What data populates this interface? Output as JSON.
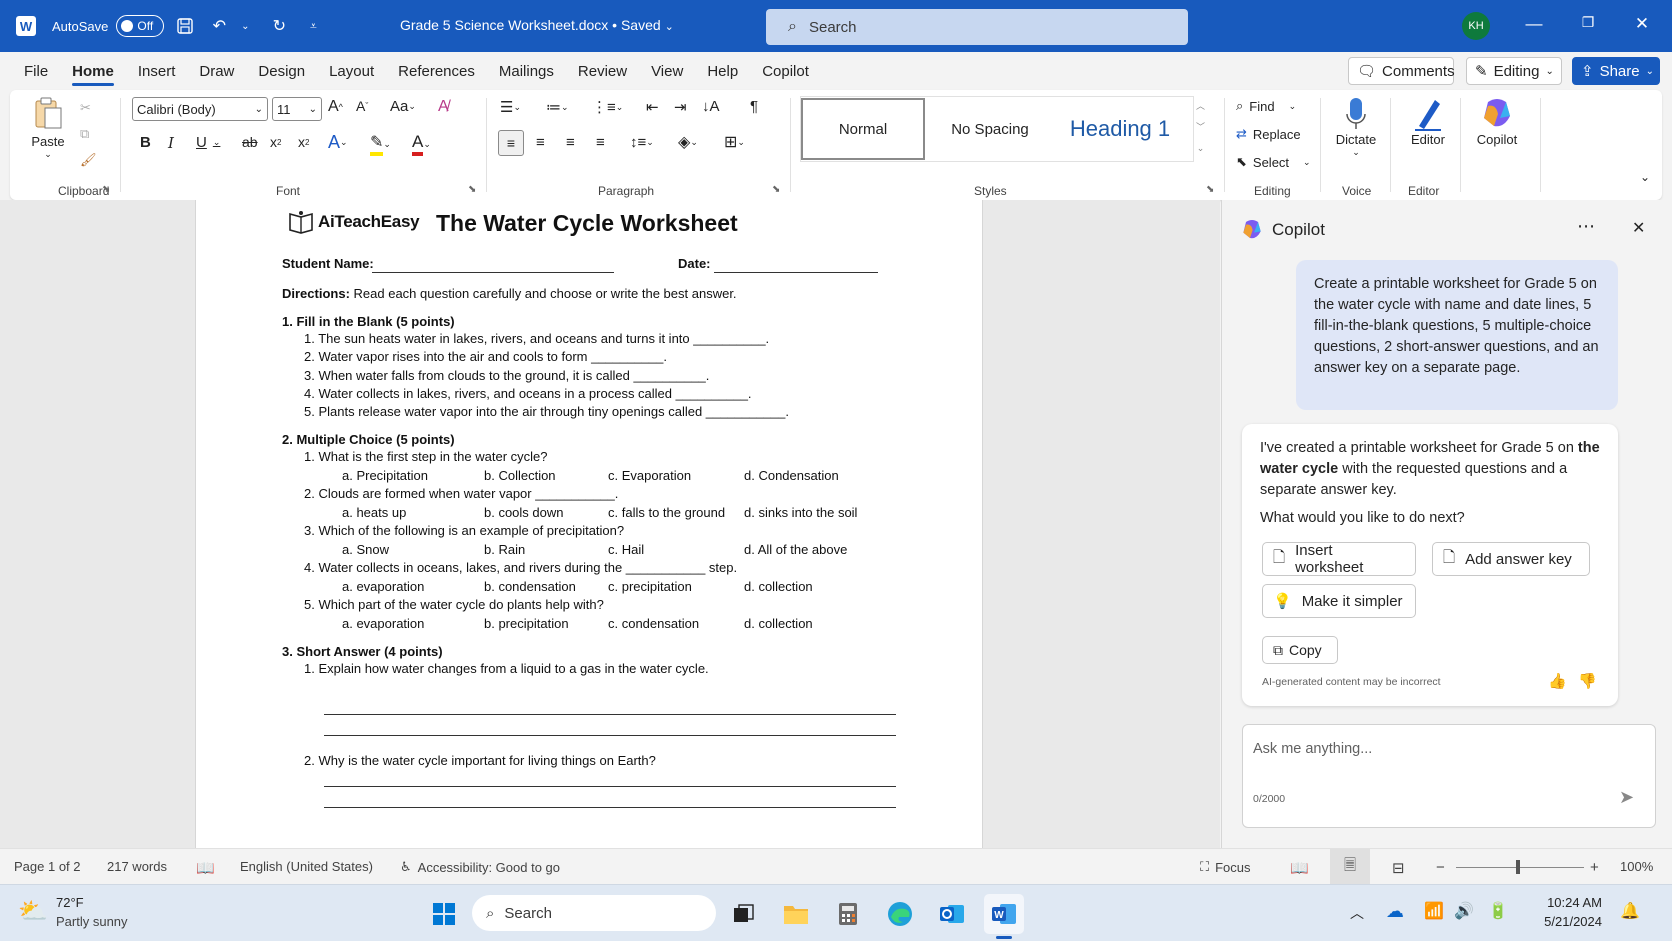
{
  "titlebar": {
    "autosave_label": "AutoSave",
    "autosave_state": "Off",
    "doc_title": "Grade 5 Science Worksheet.docx • Saved",
    "search_placeholder": "Search",
    "user_initials": "KH"
  },
  "ribbon_tabs": [
    "File",
    "Home",
    "Insert",
    "Draw",
    "Design",
    "Layout",
    "References",
    "Mailings",
    "Review",
    "View",
    "Help",
    "Copilot"
  ],
  "ribbon_right": {
    "comments": "Comments",
    "editing": "Editing",
    "share": "Share"
  },
  "ribbon": {
    "paste": "Paste",
    "clipboard_label": "Clipboard",
    "font_name": "Calibri (Body)",
    "font_size": "11",
    "font_label": "Font",
    "paragraph_label": "Paragraph",
    "styles": {
      "normal": "Normal",
      "no_spacing": "No Spacing",
      "heading1": "Heading 1",
      "label": "Styles"
    },
    "editing": {
      "find": "Find",
      "replace": "Replace",
      "select": "Select",
      "label": "Editing"
    },
    "voice": {
      "dictate": "Dictate",
      "label": "Voice"
    },
    "editor": {
      "editor": "Editor",
      "label": "Editor"
    },
    "copilot": "Copilot"
  },
  "document": {
    "logo_text": "AiTeachEasy",
    "title": "The Water Cycle Worksheet",
    "student_name_label": "Student Name:",
    "date_label": "Date:",
    "directions_label": "Directions:",
    "directions_text": "Read each question carefully and choose or write the best answer.",
    "section1": {
      "heading": "1.   Fill in the Blank (5 points)",
      "items": [
        "1.   The sun heats water in lakes, rivers, and oceans and turns it into __________.",
        "2.   Water vapor rises into the air and cools to form __________.",
        "3.   When water falls from clouds to the ground, it is called __________.",
        "4.   Water collects in lakes, rivers, and oceans in a process called __________.",
        "5.   Plants release water vapor into the air through tiny openings called ___________."
      ]
    },
    "section2": {
      "heading": "2.   Multiple Choice (5 points)",
      "questions": [
        {
          "q": "1.   What is the first step in the water cycle?",
          "a": "a.  Precipitation",
          "b": "b.  Collection",
          "c": "c.  Evaporation",
          "d": "d.  Condensation"
        },
        {
          "q": "2.   Clouds are formed when water vapor ___________.",
          "a": "a.  heats up",
          "b": "b.  cools down",
          "c": "c.  falls to the ground",
          "d": "d.  sinks into the soil"
        },
        {
          "q": "3.   Which of the following is an example of precipitation?",
          "a": "a.  Snow",
          "b": "b.  Rain",
          "c": "c.  Hail",
          "d": "d.  All of the above"
        },
        {
          "q": "4.   Water collects in oceans, lakes, and rivers during the ___________ step.",
          "a": "a.  evaporation",
          "b": "b.  condensation",
          "c": "c.  precipitation",
          "d": "d.  collection"
        },
        {
          "q": "5.   Which part of the water cycle do plants help with?",
          "a": "a.  evaporation",
          "b": "b.  precipitation",
          "c": "c.  condensation",
          "d": "d.  collection"
        }
      ]
    },
    "section3": {
      "heading": "3.   Short Answer (4 points)",
      "q1": "1.   Explain how water changes from a liquid to a gas in the water cycle.",
      "q2": "2.   Why is the water cycle important for living things on Earth?"
    }
  },
  "copilot": {
    "title": "Copilot",
    "user_message": "Create a printable worksheet for Grade 5 on the water cycle with name and date lines, 5 fill-in-the-blank questions, 5 multiple-choice questions, 2 short-answer questions, and an answer key on a separate page.",
    "ai_message_pre": "I've created a printable worksheet for Grade 5 on ",
    "ai_message_bold": "the water cycle",
    "ai_message_post": " with the requested questions and a separate answer key.",
    "ai_question": "What would you like to do next?",
    "btn_insert": "Insert worksheet",
    "btn_answer_key": "Add answer key",
    "btn_simpler": "Make it simpler",
    "btn_copy": "Copy",
    "disclaimer": "AI-generated content may be incorrect",
    "input_placeholder": "Ask me anything...",
    "char_count": "0/2000"
  },
  "statusbar": {
    "page": "Page 1 of 2",
    "words": "217 words",
    "language": "English (United States)",
    "accessibility": "Accessibility: Good to go",
    "focus": "Focus",
    "zoom": "100%"
  },
  "taskbar": {
    "weather_temp": "72°F",
    "weather_desc": "Partly sunny",
    "search": "Search",
    "time": "10:24 AM",
    "date": "5/21/2024"
  }
}
